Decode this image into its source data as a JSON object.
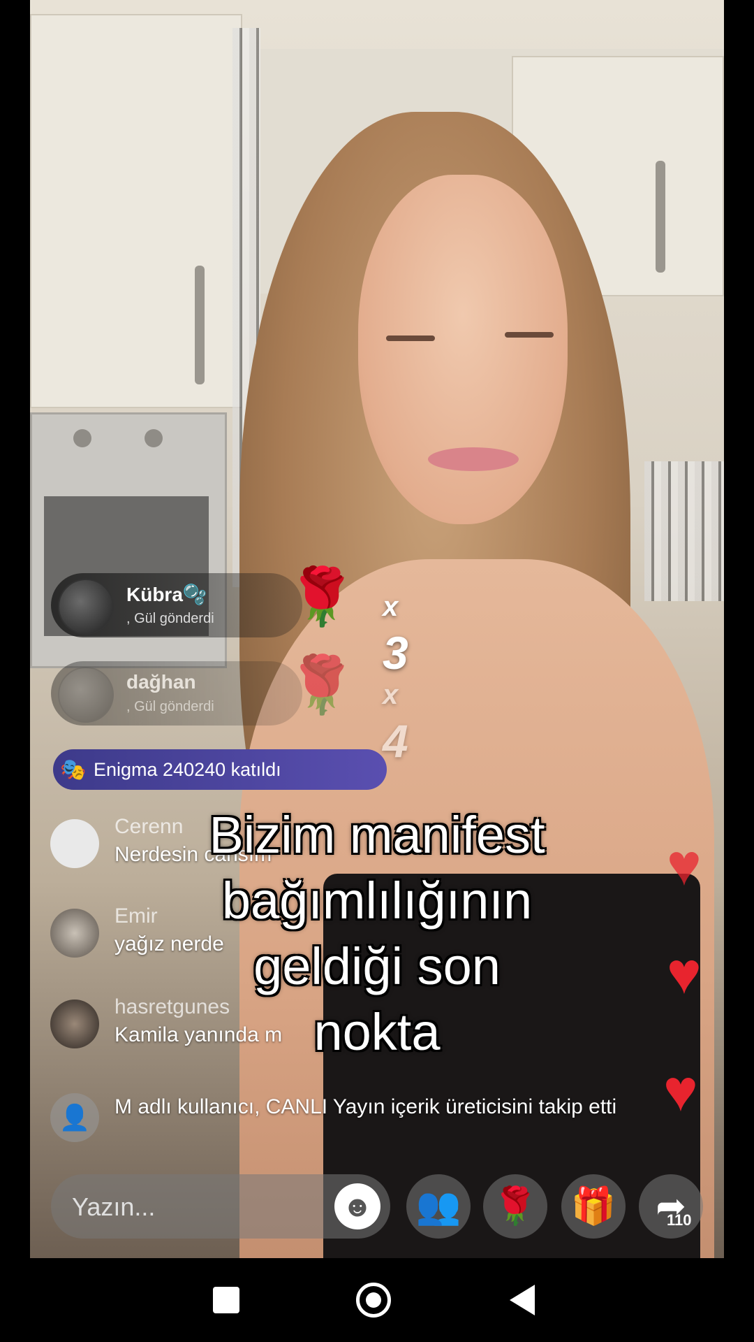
{
  "gifts": [
    {
      "user": "Kübra🫧",
      "action": ", Gül gönderdi",
      "gift_icon": "rose",
      "count": "3",
      "multiplier": "x"
    },
    {
      "user": "dağhan",
      "action": ", Gül gönderdi",
      "gift_icon": "rose",
      "count": "4",
      "multiplier": "x"
    }
  ],
  "join_banner": {
    "icon": "mask-icon",
    "text": "Enigma 240240 katıldı"
  },
  "comments": [
    {
      "user": "Cerenn",
      "text": "Nerdesin cansım"
    },
    {
      "user": "Emir",
      "text": "yağız nerde"
    },
    {
      "user": "hasretgunes",
      "text": "Kamila yanında m"
    }
  ],
  "follow_notice": "M adlı kullanıcı, CANLI Yayın içerik üreticisini takip etti",
  "caption": {
    "line1": "Bizim manifest",
    "line2": "bağımlılığının",
    "line3": "geldiği son",
    "line4": "nokta"
  },
  "input": {
    "placeholder": "Yazın..."
  },
  "actions": {
    "share_count": "110"
  },
  "colors": {
    "heart": "#e8242e",
    "join_banner": "#4a45a0"
  }
}
